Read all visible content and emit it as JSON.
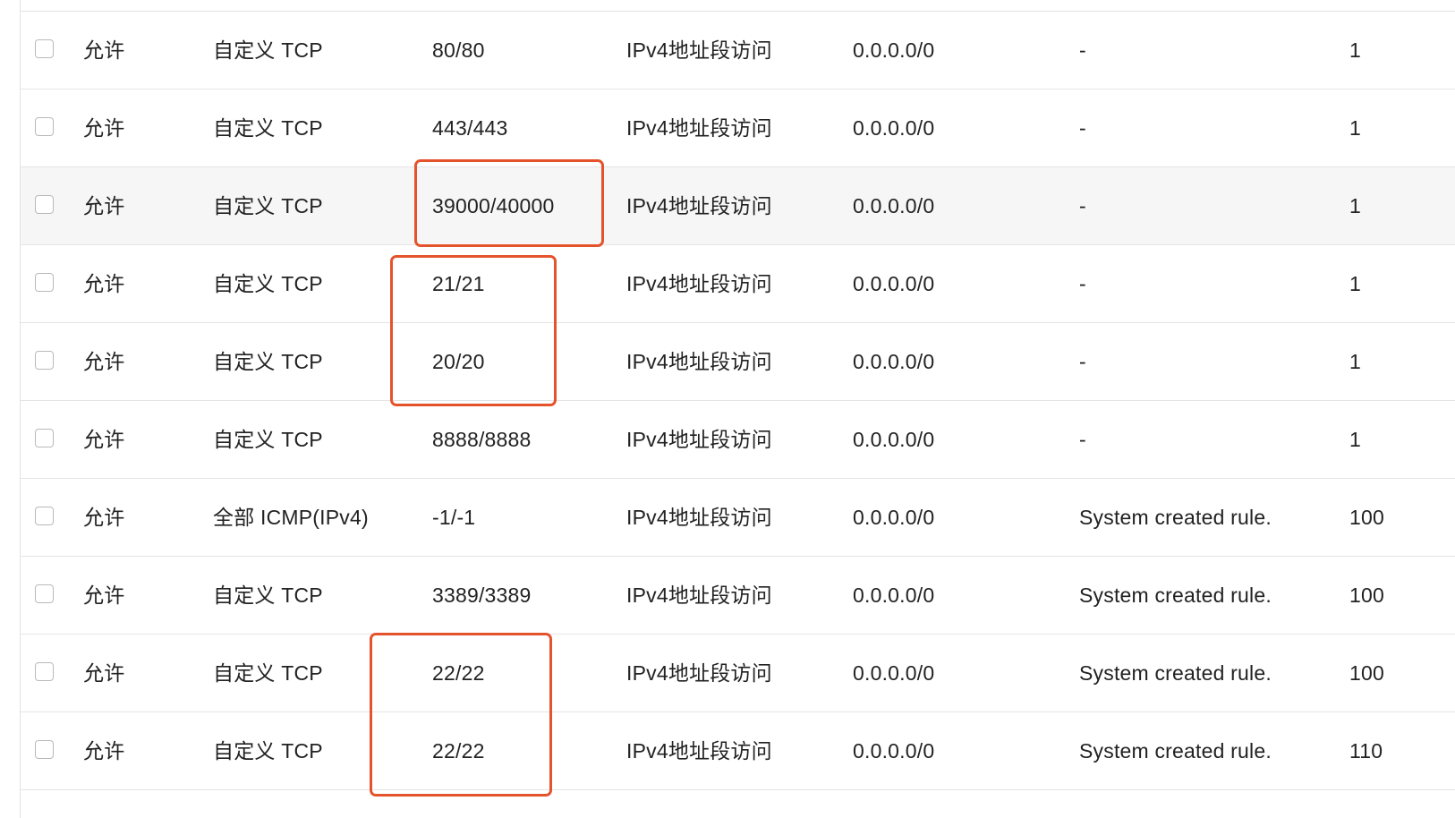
{
  "annotation_color": "#e5532d",
  "rules": [
    {
      "action": "允许",
      "protocol": "自定义 TCP",
      "port": "80/80",
      "auth_type": "IPv4地址段访问",
      "source": "0.0.0.0/0",
      "description": "-",
      "priority": "1"
    },
    {
      "action": "允许",
      "protocol": "自定义 TCP",
      "port": "443/443",
      "auth_type": "IPv4地址段访问",
      "source": "0.0.0.0/0",
      "description": "-",
      "priority": "1"
    },
    {
      "action": "允许",
      "protocol": "自定义 TCP",
      "port": "39000/40000",
      "auth_type": "IPv4地址段访问",
      "source": "0.0.0.0/0",
      "description": "-",
      "priority": "1"
    },
    {
      "action": "允许",
      "protocol": "自定义 TCP",
      "port": "21/21",
      "auth_type": "IPv4地址段访问",
      "source": "0.0.0.0/0",
      "description": "-",
      "priority": "1"
    },
    {
      "action": "允许",
      "protocol": "自定义 TCP",
      "port": "20/20",
      "auth_type": "IPv4地址段访问",
      "source": "0.0.0.0/0",
      "description": "-",
      "priority": "1"
    },
    {
      "action": "允许",
      "protocol": "自定义 TCP",
      "port": "8888/8888",
      "auth_type": "IPv4地址段访问",
      "source": "0.0.0.0/0",
      "description": "-",
      "priority": "1"
    },
    {
      "action": "允许",
      "protocol": "全部 ICMP(IPv4)",
      "port": "-1/-1",
      "auth_type": "IPv4地址段访问",
      "source": "0.0.0.0/0",
      "description": "System created rule.",
      "priority": "100"
    },
    {
      "action": "允许",
      "protocol": "自定义 TCP",
      "port": "3389/3389",
      "auth_type": "IPv4地址段访问",
      "source": "0.0.0.0/0",
      "description": "System created rule.",
      "priority": "100"
    },
    {
      "action": "允许",
      "protocol": "自定义 TCP",
      "port": "22/22",
      "auth_type": "IPv4地址段访问",
      "source": "0.0.0.0/0",
      "description": "System created rule.",
      "priority": "100"
    },
    {
      "action": "允许",
      "protocol": "自定义 TCP",
      "port": "22/22",
      "auth_type": "IPv4地址段访问",
      "source": "0.0.0.0/0",
      "description": "System created rule.",
      "priority": "110"
    }
  ]
}
